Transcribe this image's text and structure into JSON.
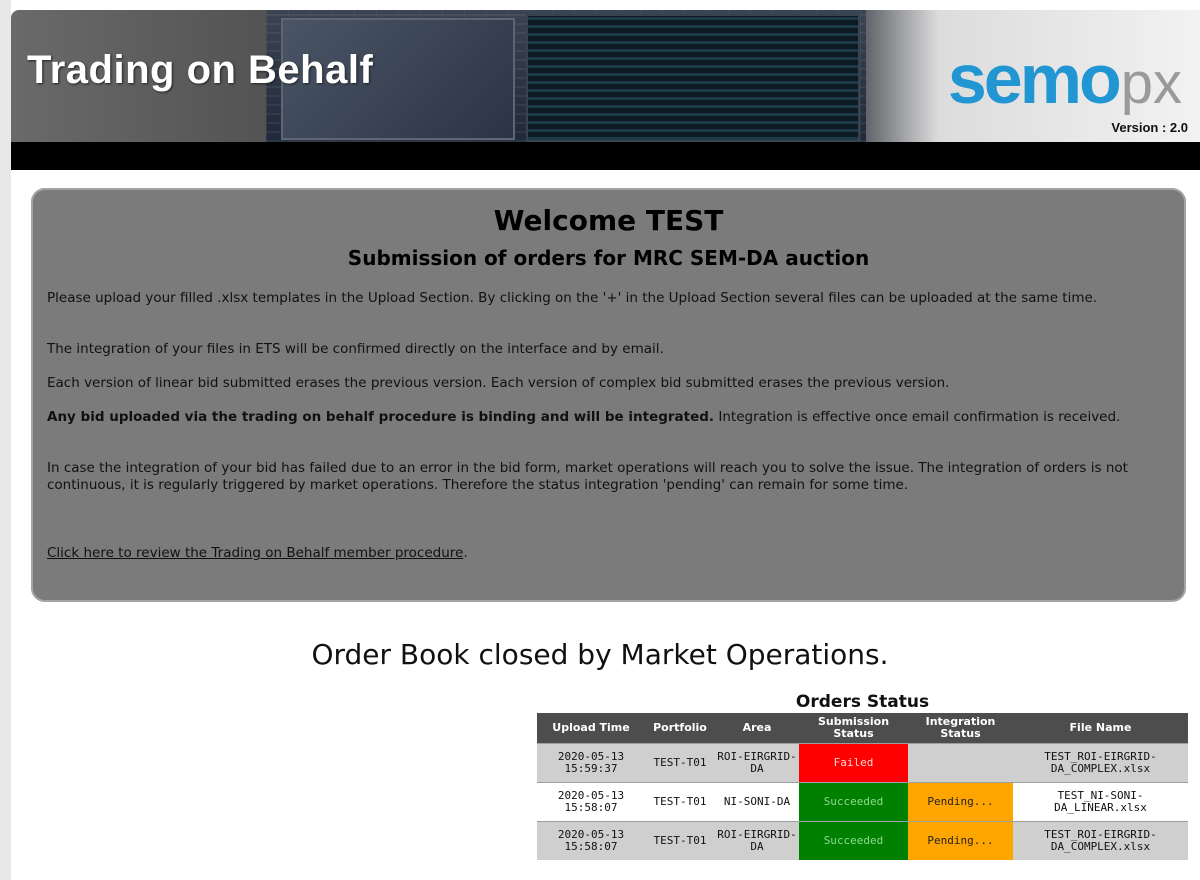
{
  "header": {
    "title": "Trading on Behalf",
    "logo_main": "semo",
    "logo_suffix": "px",
    "version": "Version : 2.0"
  },
  "welcome": {
    "heading": "Welcome TEST",
    "subheading": "Submission of orders for MRC SEM-DA auction",
    "p1": "Please upload your filled .xlsx templates in the Upload Section. By clicking on the '+' in the Upload Section several files can be uploaded at the same time.",
    "p2": "The integration of your files in ETS will be confirmed directly on the interface and by email.",
    "p3": "Each version of linear bid submitted erases the previous version. Each version of complex bid submitted erases the previous version.",
    "p4_bold": "Any bid uploaded via the trading on behalf procedure is binding and will be integrated.",
    "p4_rest": " Integration is effective once email confirmation is received.",
    "p5": "In case the integration of your bid has failed due to an error in the bid form, market operations will reach you to solve the issue. The integration of orders is not continuous, it is regularly triggered by market operations. Therefore the status integration 'pending' can remain for some time.",
    "link_text": "Click here to review the Trading on Behalf member procedure",
    "link_suffix": "."
  },
  "order_book_message": "Order Book closed by Market Operations.",
  "orders": {
    "title": "Orders Status",
    "columns": [
      "Upload Time",
      "Portfolio",
      "Area",
      "Submission Status",
      "Integration Status",
      "File Name"
    ],
    "rows": [
      {
        "time": "2020-05-13 15:59:37",
        "portfolio": "TEST-T01",
        "area": "ROI-EIRGRID-DA",
        "submission": "Failed",
        "integration": "",
        "file": "TEST_ROI-EIRGRID-DA_COMPLEX.xlsx"
      },
      {
        "time": "2020-05-13 15:58:07",
        "portfolio": "TEST-T01",
        "area": "NI-SONI-DA",
        "submission": "Succeeded",
        "integration": "Pending...",
        "file": "TEST_NI-SONI-DA_LINEAR.xlsx"
      },
      {
        "time": "2020-05-13 15:58:07",
        "portfolio": "TEST-T01",
        "area": "ROI-EIRGRID-DA",
        "submission": "Succeeded",
        "integration": "Pending...",
        "file": "TEST_ROI-EIRGRID-DA_COMPLEX.xlsx"
      }
    ]
  },
  "colors": {
    "failed": "#ff0000",
    "succeeded": "#008000",
    "pending": "#ffa500",
    "header_bg": "#4d4d4d",
    "logo_blue": "#2196d3",
    "logo_red": "#e2231a"
  }
}
